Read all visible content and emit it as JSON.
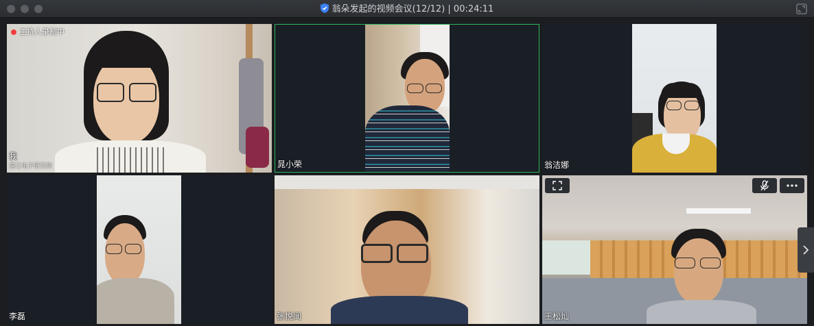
{
  "window": {
    "title": "翁朵发起的视频会议(12/12) | 00:24:11",
    "colors": {
      "active_border": "#2db55d",
      "record_dot": "#f23c3c",
      "background": "#1b1d20"
    }
  },
  "recording": {
    "label": "主持人录制中"
  },
  "participants": [
    {
      "name": "我",
      "subtitle": "湛江电子研究院",
      "active": false
    },
    {
      "name": "晁小荣",
      "active": true
    },
    {
      "name": "翁洁娜",
      "active": false
    },
    {
      "name": "李磊",
      "active": false
    },
    {
      "name": "张悦闻",
      "active": false
    },
    {
      "name": "王松灿",
      "active": false
    }
  ],
  "icons": {
    "fullscreen": "fullscreen-icon",
    "mute": "mic-muted-icon",
    "more": "more-icon",
    "next": "chevron-right-icon"
  }
}
